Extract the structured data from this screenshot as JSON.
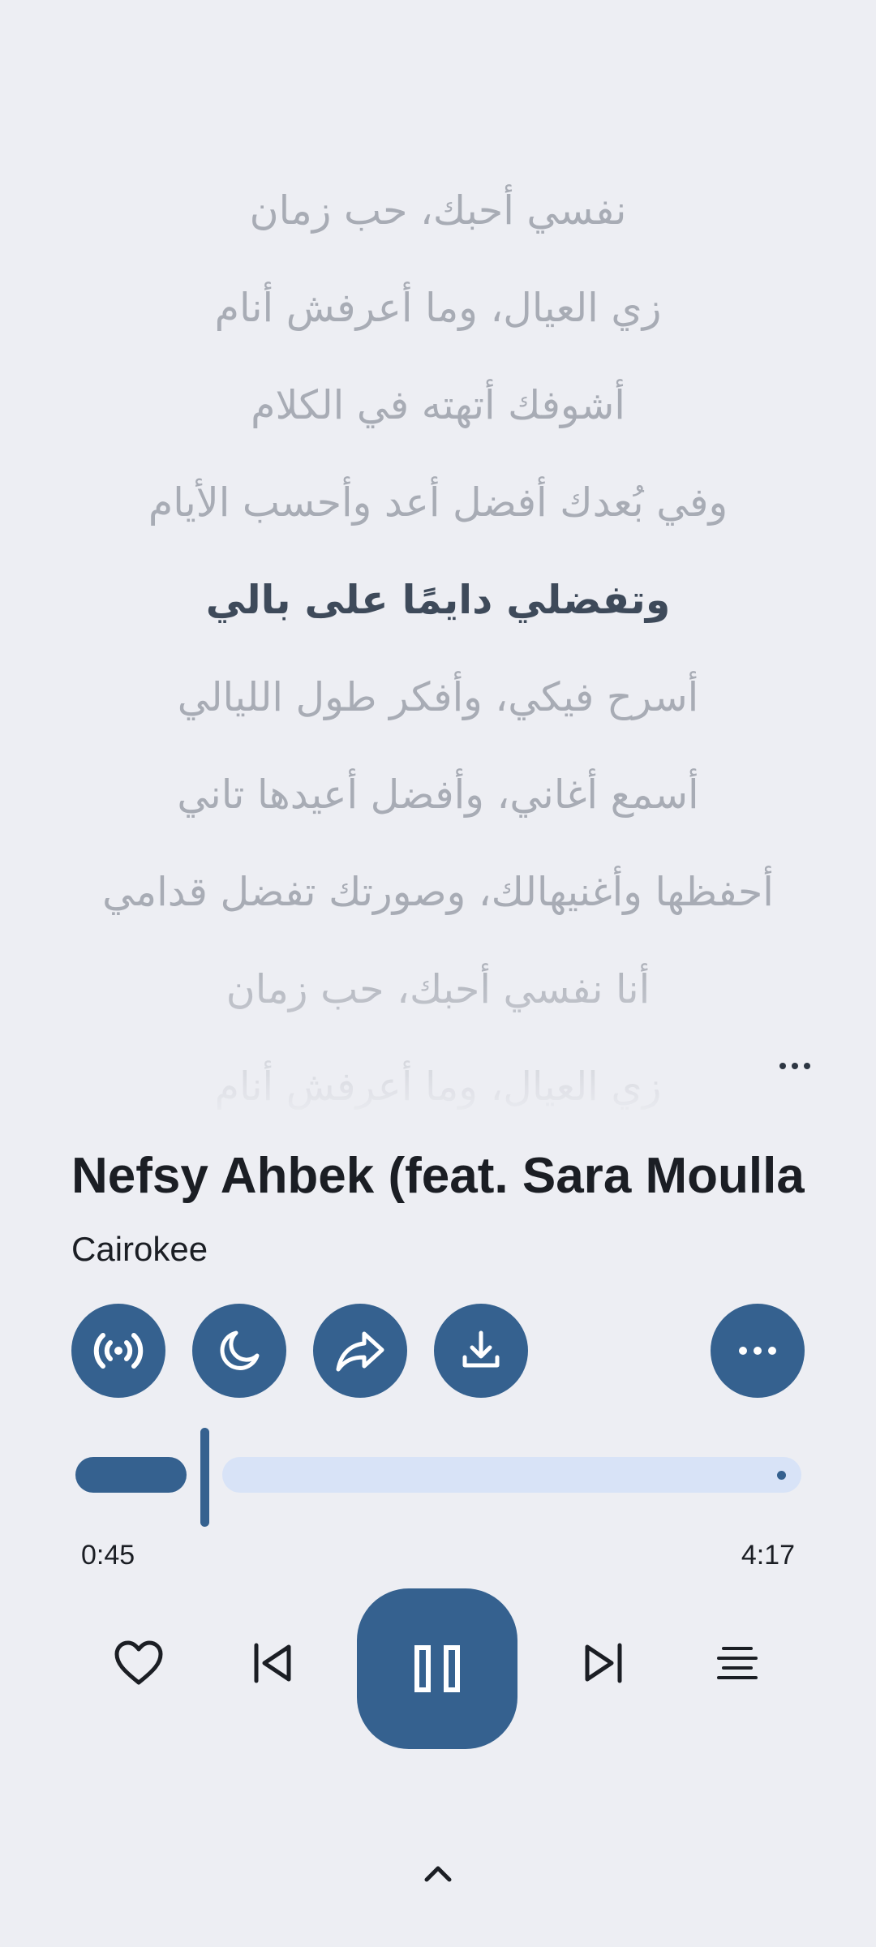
{
  "lyrics": [
    "نفسي أحبك، حب زمان",
    "زي العيال، وما أعرفش أنام",
    "أشوفك أتهته في الكلام",
    "وفي بُعدك أفضل أعد وأحسب الأيام",
    "وتفضلي دايمًا على بالي",
    "أسرح فيكي، وأفكر طول الليالي",
    "أسمع أغاني، وأفضل أعيدها تاني",
    "أحفظها وأغنيهالك، وصورتك تفضل قدامي",
    "أنا نفسي أحبك، حب زمان",
    "زي العيال، وما أعرفش أنام"
  ],
  "active_lyric_index": 4,
  "track": {
    "title": "Nefsy Ahbek (feat. Sara Moullablad)",
    "artist": "Cairokee"
  },
  "actions": [
    {
      "name": "broadcast-icon"
    },
    {
      "name": "sleep-timer-icon"
    },
    {
      "name": "share-icon"
    },
    {
      "name": "download-icon"
    },
    {
      "name": "more-icon"
    }
  ],
  "playback": {
    "elapsed": "0:45",
    "total": "4:17",
    "progress_fraction": 0.175
  },
  "controls": {
    "favorite": "heart-icon",
    "previous": "skip-previous-icon",
    "play_pause": "pause-icon",
    "next": "skip-next-icon",
    "lyrics": "lyrics-icon"
  },
  "colors": {
    "accent": "#35618f",
    "track_bg": "#d8e3f7",
    "background": "#edeef3"
  }
}
